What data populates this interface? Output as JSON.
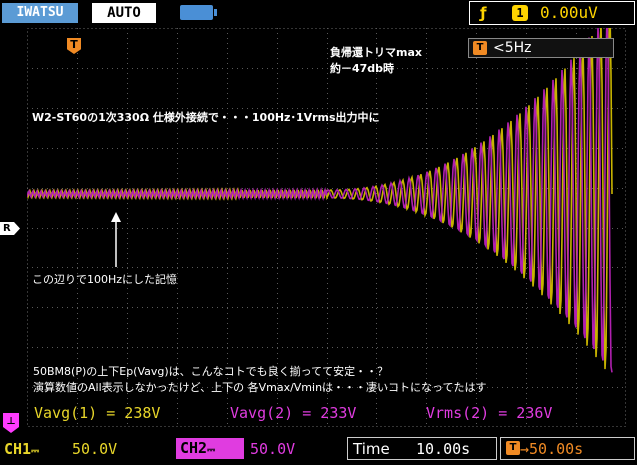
{
  "header": {
    "brand": "IWATSU",
    "mode": "AUTO",
    "trigger_source": "1",
    "trigger_level": "0.00uV"
  },
  "markers": {
    "trigger_position": "T",
    "ref": "R"
  },
  "filter": {
    "icon": "T",
    "label": "<5Hz"
  },
  "annotations": {
    "top_right_line1": "負帰還トリマmax",
    "top_right_line2": "約－47db時",
    "headline": "W2-ST60の1次330Ω 仕様外接続で・・・100Hz･1Vrms出力中に",
    "arrow_note": "この辺りで100Hzにした記憶",
    "bottom_line1": "50BM8(P)の上下Ep(Vavg)は、こんなコトでも良く揃ってて安定・・？",
    "bottom_line2": "演算数値のAll表示しなかったけど、上下の 各Vmax/Vminは・・・凄いコトになってたはす"
  },
  "measurements": [
    {
      "label": "Vavg(1) = 238V",
      "color": "#e8d62a"
    },
    {
      "label": "Vavg(2) = 233V",
      "color": "#e03ce0"
    },
    {
      "label": "Vrms(2) = 236V",
      "color": "#e03ce0"
    }
  ],
  "footer": {
    "ch1_label": "CH1",
    "ch1_scale": "50.0V",
    "ch2_label": "CH2",
    "ch2_scale": "50.0V",
    "time_label": "Time",
    "time_value": "10.00s",
    "delay_icon": "T",
    "delay_value": "→50.00s"
  },
  "colors": {
    "ch1": "#c8b400",
    "ch2": "#b020b0",
    "trigger": "#f08a24",
    "brand_bg": "#5b9bd5"
  }
}
